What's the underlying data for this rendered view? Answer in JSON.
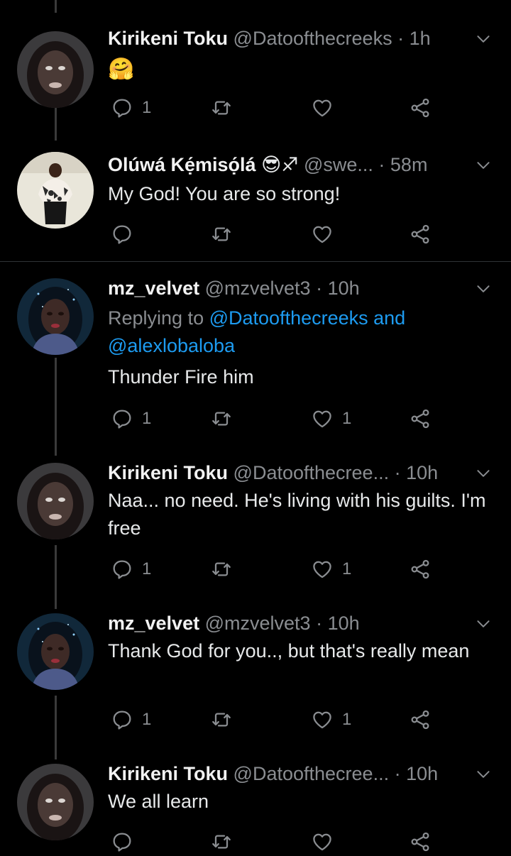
{
  "tweets": [
    {
      "name": "Kirikeni Toku",
      "handle": "@Datoofthecreeks",
      "time": "· 1h",
      "text": "🤗",
      "reply_count": "1",
      "like_count": ""
    },
    {
      "name": "Olúwá Kẹ́misọ́lá",
      "name_emojis": "😎♐",
      "handle": "@swe...",
      "time": "· 58m",
      "text": "My God! You are so strong!",
      "reply_count": "",
      "like_count": ""
    },
    {
      "name": "mz_velvet",
      "handle": "@mzvelvet3",
      "time": "· 10h",
      "replying_prefix": "Replying to",
      "replying_to_1": "@Datoofthecreeks",
      "replying_and": "and",
      "replying_to_2": "@alexlobaloba",
      "text": "Thunder Fire him",
      "reply_count": "1",
      "like_count": "1"
    },
    {
      "name": "Kirikeni Toku",
      "handle": "@Datoofthecree...",
      "time": "· 10h",
      "text": "Naa... no need. He's living with his guilts. I'm free",
      "reply_count": "1",
      "like_count": "1"
    },
    {
      "name": "mz_velvet",
      "handle": "@mzvelvet3",
      "time": "· 10h",
      "text": "Thank God for you.., but that's really mean",
      "reply_count": "1",
      "like_count": "1"
    },
    {
      "name": "Kirikeni Toku",
      "handle": "@Datoofthecree...",
      "time": "· 10h",
      "text": "We all learn",
      "reply_count": "",
      "like_count": ""
    }
  ],
  "icons": {
    "reply": "reply-icon",
    "retweet": "retweet-icon",
    "like": "like-icon",
    "share": "share-icon",
    "more": "chevron-down-icon"
  },
  "colors": {
    "background": "#000000",
    "link": "#1d9bf0",
    "muted": "#8a8d91",
    "text": "#e7e9ea"
  }
}
